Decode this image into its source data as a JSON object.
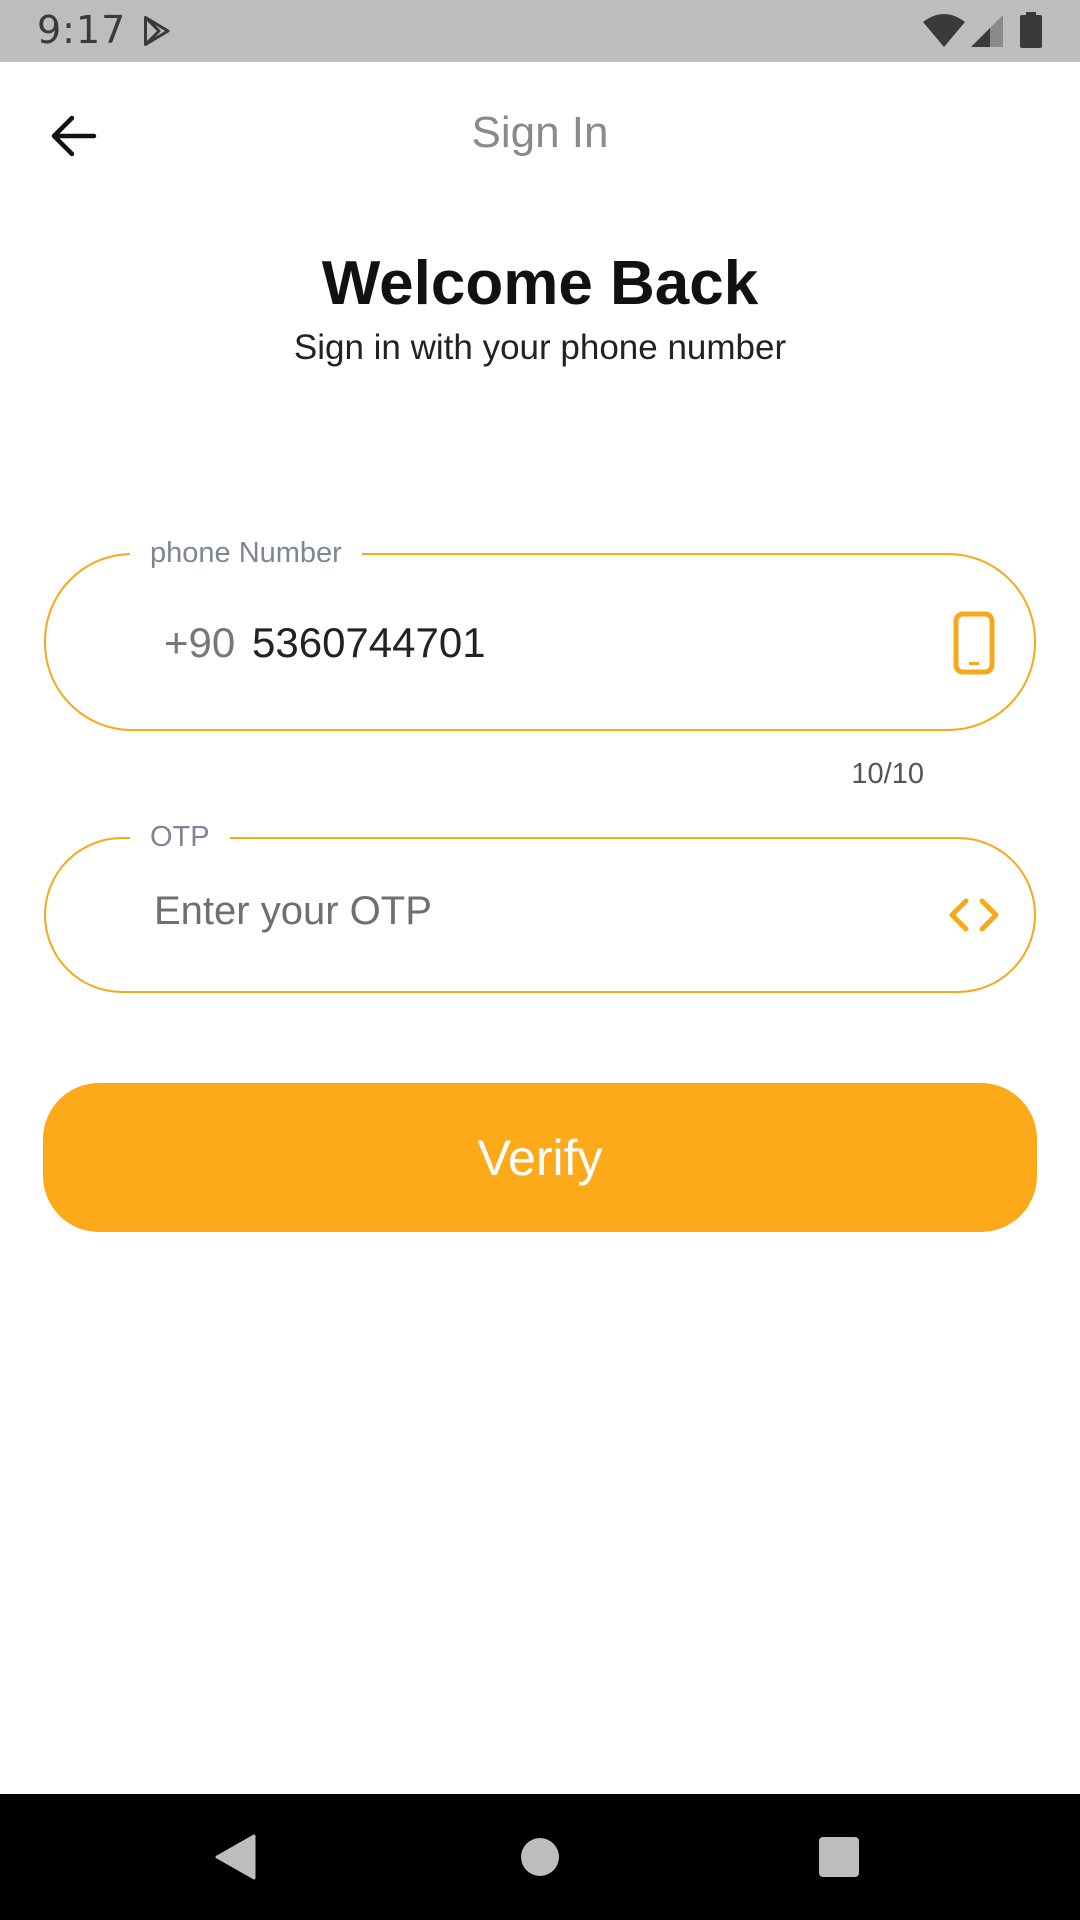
{
  "status_bar": {
    "time": "9:17",
    "icons": [
      "play-store-icon",
      "wifi-icon",
      "signal-icon",
      "battery-icon"
    ]
  },
  "app_bar": {
    "title": "Sign In",
    "back_icon": "arrow-back-icon"
  },
  "welcome": {
    "title": "Welcome Back",
    "subtitle": "Sign in with your phone number"
  },
  "phone_field": {
    "label": "phone Number",
    "prefix": "+90",
    "value": "5360744701",
    "counter": "10/10",
    "icon": "smartphone-icon"
  },
  "otp_field": {
    "label": "OTP",
    "placeholder": "Enter your OTP",
    "value": "",
    "icon": "code-icon"
  },
  "verify_button": {
    "label": "Verify"
  },
  "nav_bar": {
    "icons": [
      "nav-back-icon",
      "nav-home-icon",
      "nav-recents-icon"
    ]
  },
  "colors": {
    "accent": "#fca91a",
    "field_border": "#f7a81b",
    "status_bar": "#bdbdbd",
    "nav_bar": "#000000"
  }
}
